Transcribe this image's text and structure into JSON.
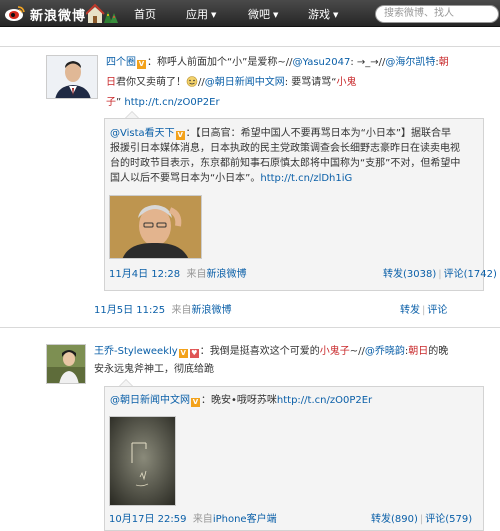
{
  "header": {
    "logo_text": "新浪微博",
    "nav": [
      {
        "label": "首页",
        "has_caret": false
      },
      {
        "label": "应用",
        "has_caret": true
      },
      {
        "label": "微吧",
        "has_caret": true
      },
      {
        "label": "游戏",
        "has_caret": true
      }
    ],
    "search_placeholder": "搜索微博、找人"
  },
  "post1": {
    "author": "四个圈",
    "body_line1": {
      "t1": "：称呼人前面加个“小”是爱称~//",
      "t2": "@Yasu2047",
      "t3": ": →_→//",
      "t4": "@海尔凯特",
      "t5": ":",
      "t6": "朝"
    },
    "body_line2": {
      "t1": "日",
      "t2": "君你又卖萌了！",
      "t3": "//",
      "t4": "@朝日新闻中文网",
      "t5": ": 要骂请骂“",
      "t6": "小鬼"
    },
    "body_line3": {
      "t1": "子",
      "t2": "” ",
      "t3": "http://t.cn/zO0P2Er"
    },
    "repost": {
      "author": "@Vista看天下",
      "lines": [
        "：【日高官：希望中国人不要再骂日本为“小日本”】据联合早",
        "报援引日本媒体消息，日本执政的民主党政策调查会长细野志豪昨日在读卖电视",
        "台的时政节目表示，东京都前知事石原慎太郎将中国称为“支那”不对，但希望中",
        "国人以后不要骂日本为“小日本”。"
      ],
      "link": "http://t.cn/zlDh1iG",
      "time": "11月4日 12:28",
      "source_prefix": "来自",
      "source": "新浪微博",
      "repost_label": "转发(3038)",
      "comment_label": "评论(1742)"
    },
    "time": "11月5日 11:25",
    "source_prefix": "来自",
    "source": "新浪微博",
    "repost_label": "转发",
    "comment_label": "评论"
  },
  "post2": {
    "author": "王乔-Styleweekly",
    "body_line1": {
      "t1": "：我倒是挺喜欢这个可爱的",
      "t2": "小鬼子",
      "t3": "~//",
      "t4": "@乔晓韵",
      "t5": ":",
      "t6": "朝日",
      "t7": "的晚"
    },
    "body_line2": "安永远鬼斧神工，彻底给跪",
    "repost": {
      "author": "@朝日新闻中文网",
      "text": "晚安•哦呀苏咪",
      "link": "http://t.cn/zO0P2Er",
      "time": "10月17日 22:59",
      "source_prefix": "来自",
      "source": "iPhone客户端",
      "repost_label": "转发(890)",
      "comment_label": "评论(579)"
    }
  },
  "colors": {
    "link": "#0a5fa8",
    "highlight": "#c8282a",
    "topbar": "#333333",
    "repost_bg": "#f4f4f4"
  }
}
